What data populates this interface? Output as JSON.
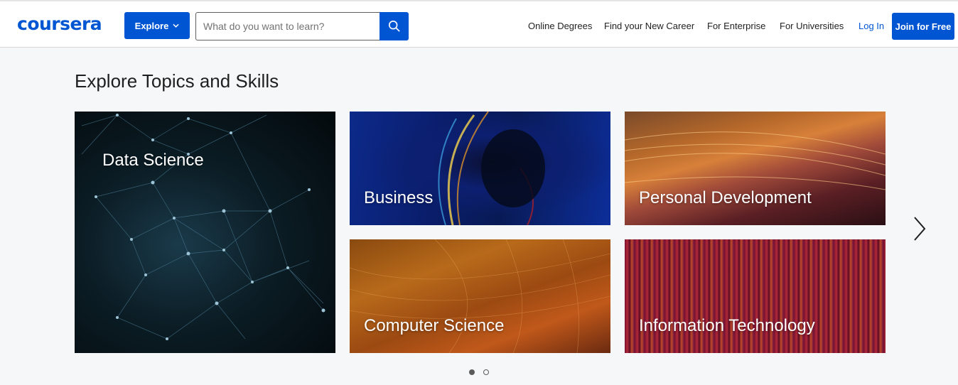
{
  "header": {
    "logo_text": "coursera",
    "explore_label": "Explore",
    "search": {
      "placeholder": "What do you want to learn?",
      "value": ""
    },
    "nav_links": [
      "Online Degrees",
      "Find your New Career",
      "For Enterprise",
      "For Universities"
    ],
    "login_label": "Log In",
    "join_label": "Join for Free"
  },
  "main": {
    "section_title": "Explore Topics and Skills",
    "topics": [
      {
        "label": "Data Science"
      },
      {
        "label": "Business"
      },
      {
        "label": "Personal Development"
      },
      {
        "label": "Computer Science"
      },
      {
        "label": "Information Technology"
      }
    ],
    "carousel": {
      "current_page": 1,
      "total_pages": 2
    }
  },
  "colors": {
    "brand": "#0056d2",
    "page_background": "#f5f7f8"
  },
  "icons": [
    "chevron-down-icon",
    "search-icon",
    "chevron-right-icon"
  ]
}
